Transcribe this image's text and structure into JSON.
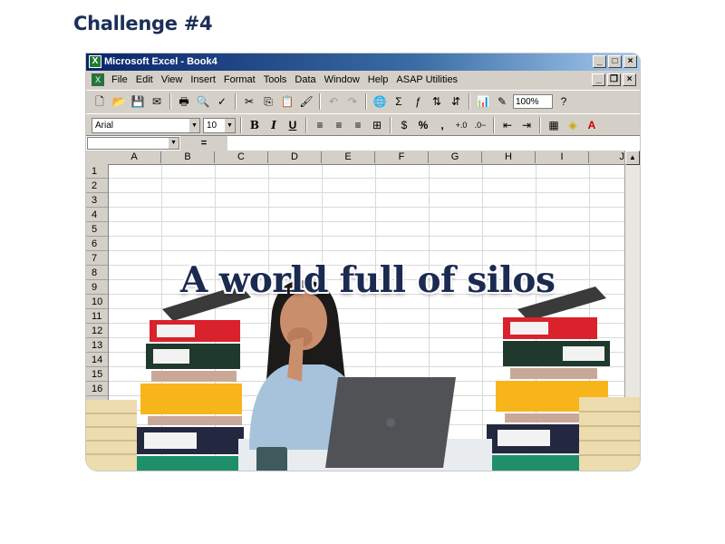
{
  "page": {
    "heading": "Challenge #4"
  },
  "window": {
    "title": "Microsoft Excel - Book4",
    "min": "_",
    "max": "□",
    "close": "×"
  },
  "menu": {
    "items": [
      "File",
      "Edit",
      "View",
      "Insert",
      "Format",
      "Tools",
      "Data",
      "Window",
      "Help",
      "ASAP Utilities"
    ],
    "min": "_",
    "restore": "❐",
    "close": "×"
  },
  "toolbar": {
    "zoom": "100%"
  },
  "format": {
    "font": "Arial",
    "size": "10",
    "bold": "B",
    "italic": "I",
    "underline": "U",
    "percent": "%",
    "comma": ","
  },
  "formula": {
    "equals": "="
  },
  "sheet": {
    "columns": [
      "A",
      "B",
      "C",
      "D",
      "E",
      "F",
      "G",
      "H",
      "I",
      "J"
    ],
    "rows": [
      "1",
      "2",
      "3",
      "4",
      "5",
      "6",
      "7",
      "8",
      "9",
      "10",
      "11",
      "12",
      "13",
      "14",
      "15",
      "16"
    ]
  },
  "overlay": {
    "headline": "A world full of silos"
  }
}
